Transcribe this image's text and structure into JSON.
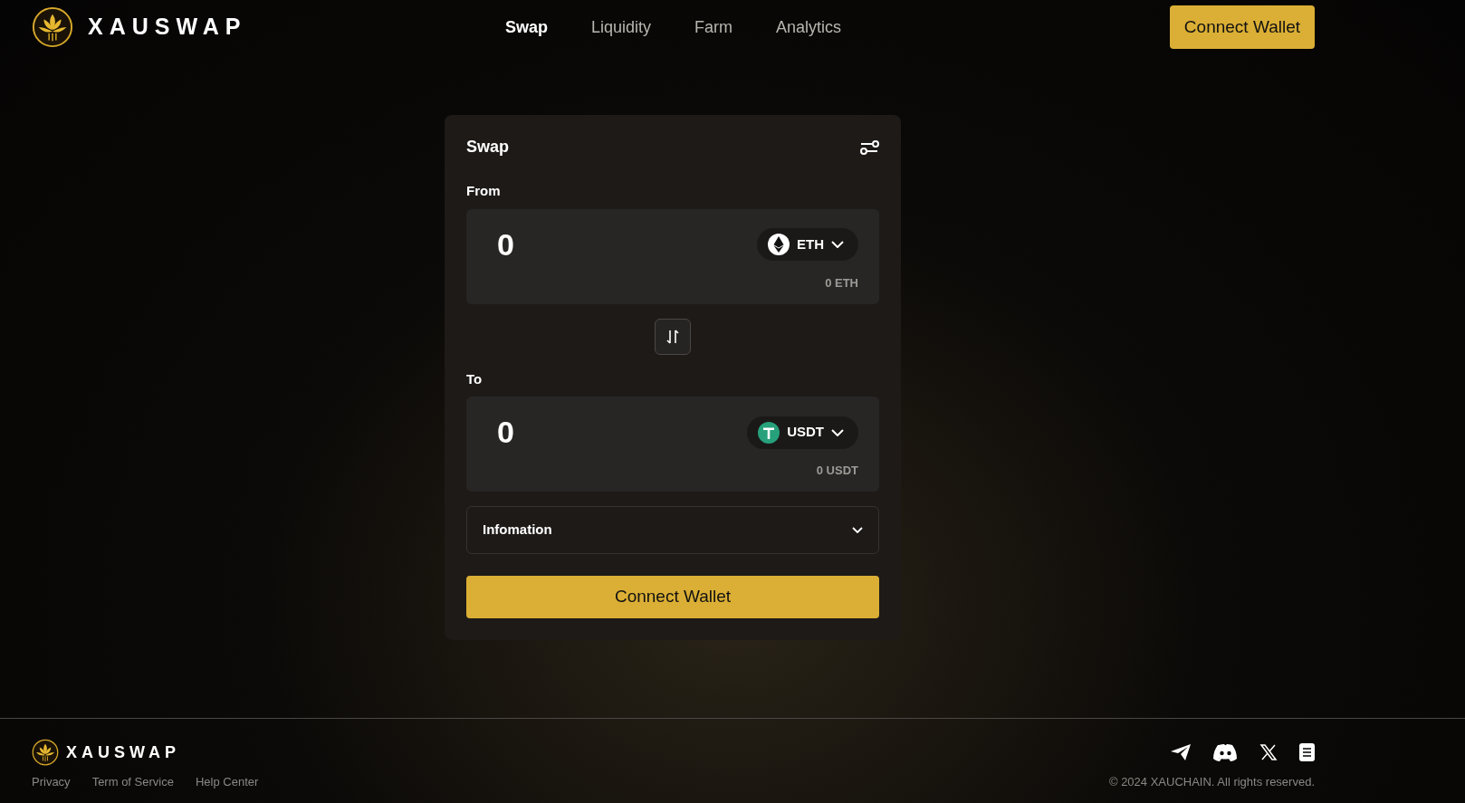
{
  "brand": "XAUSWAP",
  "nav": [
    {
      "label": "Swap",
      "selected": true
    },
    {
      "label": "Liquidity",
      "selected": false
    },
    {
      "label": "Farm",
      "selected": false
    },
    {
      "label": "Analytics",
      "selected": false
    }
  ],
  "header_button": "Connect Wallet",
  "swap": {
    "title": "Swap",
    "from": {
      "label": "From",
      "amount": "0",
      "token": "ETH",
      "kind": "eth",
      "balance": "0 ETH"
    },
    "to": {
      "label": "To",
      "amount": "0",
      "token": "USDT",
      "kind": "usdt",
      "balance": "0 USDT"
    },
    "info": {
      "label": "Infomation",
      "expanded": false
    },
    "button": "Connect Wallet"
  },
  "footer": {
    "brand": "XAUSWAP",
    "links": [
      "Privacy",
      "Term of Service",
      "Help Center"
    ],
    "copyright": "© 2024 XAUCHAIN. All rights reserved."
  }
}
